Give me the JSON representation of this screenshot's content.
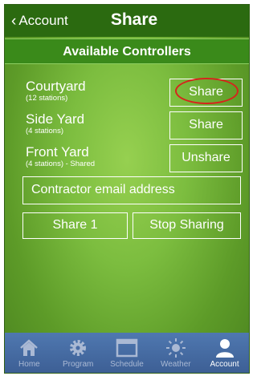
{
  "topbar": {
    "back_label": "Account",
    "title": "Share"
  },
  "section_title": "Available Controllers",
  "controllers": [
    {
      "name": "Courtyard",
      "detail": "(12 stations)",
      "action": "Share"
    },
    {
      "name": "Side Yard",
      "detail": "(4 stations)",
      "action": "Share"
    },
    {
      "name": "Front Yard",
      "detail": "(4 stations) - Shared",
      "action": "Unshare"
    }
  ],
  "email_placeholder": "Contractor email address",
  "buttons": {
    "share": "Share 1",
    "stop": "Stop Sharing"
  },
  "tabs": [
    "Home",
    "Program",
    "Schedule",
    "Weather",
    "Account"
  ],
  "colors": {
    "header": "#2b6a10",
    "highlight": "#d6241c",
    "tabbar": "#4a6ea6"
  }
}
